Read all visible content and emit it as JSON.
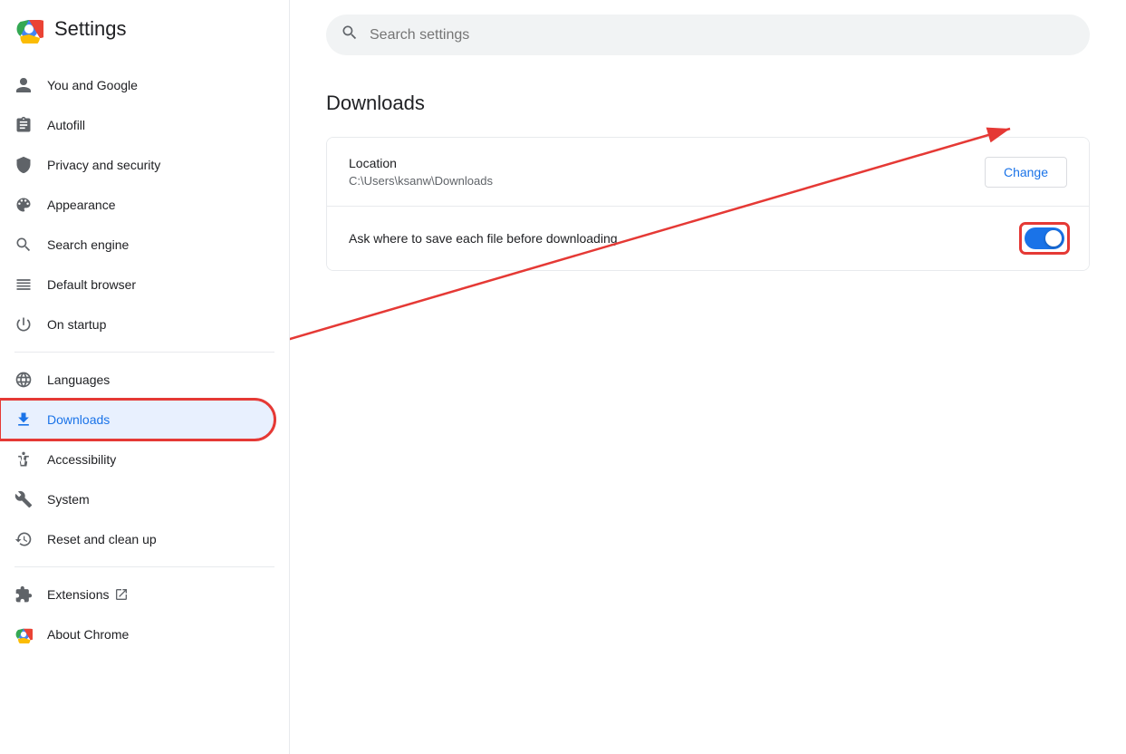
{
  "sidebar": {
    "title": "Settings",
    "items_top": [
      {
        "id": "you-and-google",
        "label": "You and Google",
        "icon": "person"
      },
      {
        "id": "autofill",
        "label": "Autofill",
        "icon": "assignment"
      },
      {
        "id": "privacy-security",
        "label": "Privacy and security",
        "icon": "shield"
      },
      {
        "id": "appearance",
        "label": "Appearance",
        "icon": "palette"
      },
      {
        "id": "search-engine",
        "label": "Search engine",
        "icon": "search"
      },
      {
        "id": "default-browser",
        "label": "Default browser",
        "icon": "crop_square"
      },
      {
        "id": "on-startup",
        "label": "On startup",
        "icon": "power_settings_new"
      }
    ],
    "items_middle": [
      {
        "id": "languages",
        "label": "Languages",
        "icon": "language"
      },
      {
        "id": "downloads",
        "label": "Downloads",
        "icon": "download",
        "active": true
      },
      {
        "id": "accessibility",
        "label": "Accessibility",
        "icon": "accessibility"
      },
      {
        "id": "system",
        "label": "System",
        "icon": "settings"
      },
      {
        "id": "reset-clean-up",
        "label": "Reset and clean up",
        "icon": "history"
      }
    ],
    "items_bottom": [
      {
        "id": "extensions",
        "label": "Extensions",
        "icon": "extension",
        "external": true
      },
      {
        "id": "about-chrome",
        "label": "About Chrome",
        "icon": "info"
      }
    ]
  },
  "search": {
    "placeholder": "Search settings",
    "value": ""
  },
  "main": {
    "page_title": "Downloads",
    "location_label": "Location",
    "location_path": "C:\\Users\\ksanw\\Downloads",
    "change_button_label": "Change",
    "ask_save_label": "Ask where to save each file before downloading"
  }
}
